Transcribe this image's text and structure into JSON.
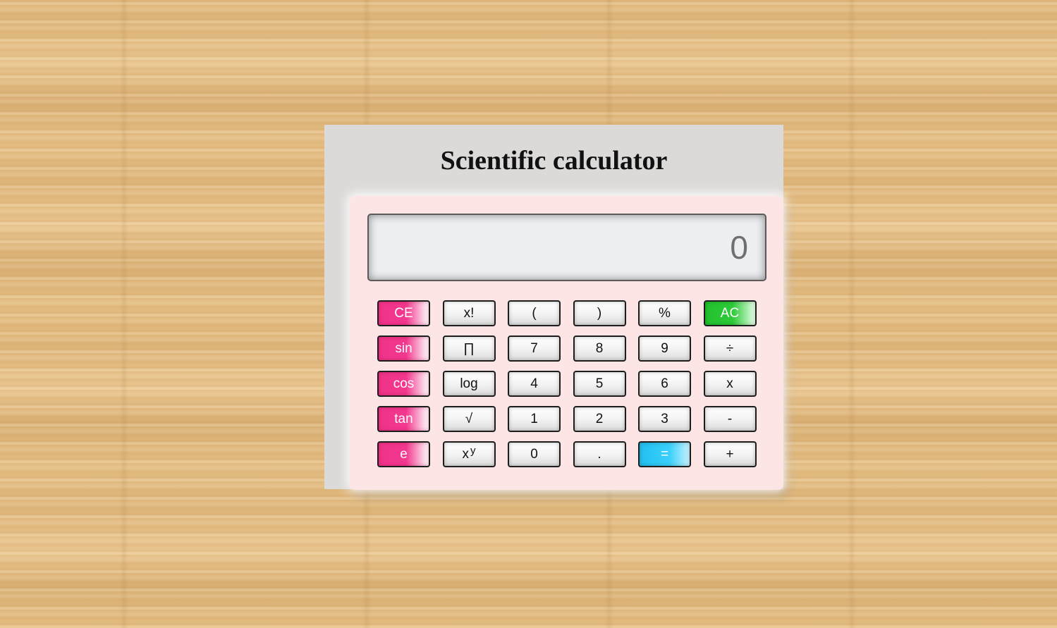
{
  "app": {
    "title": "Scientific calculator"
  },
  "display": {
    "value": "0"
  },
  "keys": [
    {
      "label": "CE",
      "style": "pink"
    },
    {
      "label": "x!",
      "style": "plain"
    },
    {
      "label": "(",
      "style": "plain"
    },
    {
      "label": ")",
      "style": "plain"
    },
    {
      "label": "%",
      "style": "plain"
    },
    {
      "label": "AC",
      "style": "green"
    },
    {
      "label": "sin",
      "style": "pink"
    },
    {
      "label": "∏",
      "style": "plain"
    },
    {
      "label": "7",
      "style": "plain"
    },
    {
      "label": "8",
      "style": "plain"
    },
    {
      "label": "9",
      "style": "plain"
    },
    {
      "label": "÷",
      "style": "plain"
    },
    {
      "label": "cos",
      "style": "pink"
    },
    {
      "label": "log",
      "style": "plain"
    },
    {
      "label": "4",
      "style": "plain"
    },
    {
      "label": "5",
      "style": "plain"
    },
    {
      "label": "6",
      "style": "plain"
    },
    {
      "label": "x",
      "style": "plain"
    },
    {
      "label": "tan",
      "style": "pink"
    },
    {
      "label": "√",
      "style": "plain"
    },
    {
      "label": "1",
      "style": "plain"
    },
    {
      "label": "2",
      "style": "plain"
    },
    {
      "label": "3",
      "style": "plain"
    },
    {
      "label": "-",
      "style": "plain"
    },
    {
      "label": "e",
      "style": "pink"
    },
    {
      "label": "x",
      "sup": "y",
      "style": "plain"
    },
    {
      "label": "0",
      "style": "plain"
    },
    {
      "label": ".",
      "style": "plain"
    },
    {
      "label": "=",
      "style": "blue"
    },
    {
      "label": "+",
      "style": "plain"
    }
  ],
  "colors": {
    "function_key": "#f0338a",
    "clear_all_key": "#22c12e",
    "equals_key": "#21bff0",
    "calculator_body": "#fde5e6",
    "display_background": "#eceef1"
  }
}
